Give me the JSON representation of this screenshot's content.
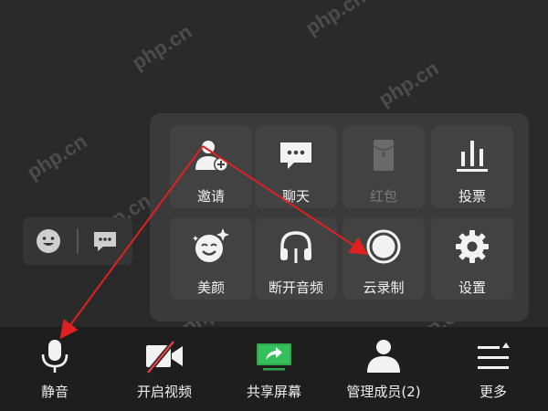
{
  "watermark": "php.cn",
  "colors": {
    "background": "#2a2a2a",
    "panel": "#3a3a3a",
    "tile": "#424242",
    "bottombar": "#1e1e1e",
    "share_green": "#2ea84a",
    "video_red": "#e04040",
    "annotation_red": "#e02020",
    "disabled_text": "#7a7a7a"
  },
  "left_pill": {
    "emoji_icon": "emoji-face-icon",
    "chat_icon": "chat-bubble-icon"
  },
  "panel": {
    "tiles": [
      {
        "label": "邀请",
        "icon": "invite-user-icon",
        "enabled": true
      },
      {
        "label": "聊天",
        "icon": "chat-bubble-icon",
        "enabled": true
      },
      {
        "label": "红包",
        "icon": "red-packet-icon",
        "enabled": false
      },
      {
        "label": "投票",
        "icon": "vote-bars-icon",
        "enabled": true
      },
      {
        "label": "美颜",
        "icon": "beauty-face-icon",
        "enabled": true
      },
      {
        "label": "断开音频",
        "icon": "headphones-icon",
        "enabled": true
      },
      {
        "label": "云录制",
        "icon": "record-circle-icon",
        "enabled": true
      },
      {
        "label": "设置",
        "icon": "gear-icon",
        "enabled": true
      }
    ]
  },
  "bottombar": {
    "items": [
      {
        "label": "静音",
        "icon": "microphone-icon"
      },
      {
        "label": "开启视频",
        "icon": "video-off-icon"
      },
      {
        "label": "共享屏幕",
        "icon": "share-screen-icon"
      },
      {
        "label": "管理成员(2)",
        "icon": "members-icon"
      },
      {
        "label": "更多",
        "icon": "more-menu-icon"
      }
    ]
  }
}
